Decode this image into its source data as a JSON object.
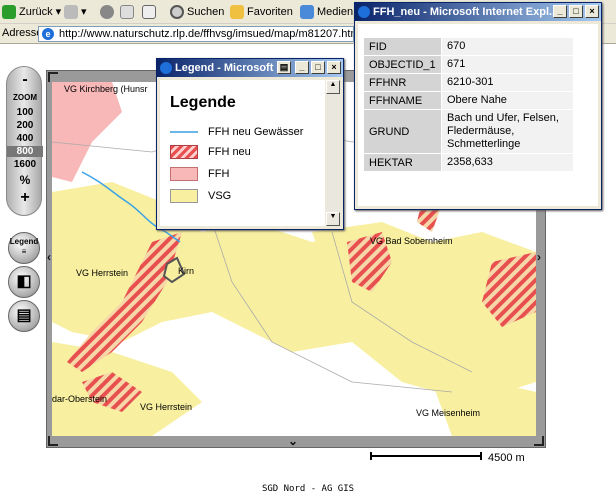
{
  "toolbar": {
    "back": "Zurück",
    "search": "Suchen",
    "favorites": "Favoriten",
    "media": "Medien"
  },
  "address": {
    "label": "Adresse",
    "url": "http://www.naturschutz.rlp.de/ffhvsg/imsued/map/m81207.html"
  },
  "zoom": {
    "minus": "-",
    "label": "ZOOM",
    "levels": [
      "100",
      "200",
      "400",
      "800",
      "1600"
    ],
    "selected": "800",
    "percent": "%",
    "plus": "+"
  },
  "side_buttons": {
    "legend": "Legend"
  },
  "map": {
    "labels": [
      "VG Kirchberg (Hunsr",
      "VG Bad Sobernheim",
      "VG Herrstein",
      "Kirn",
      "dar-Oberstein",
      "VG Herrstein",
      "VG Meisenheim"
    ],
    "scale_label": "4500 m"
  },
  "legend_window": {
    "title": "Legend - Microsoft",
    "heading": "Legende",
    "items": [
      {
        "label": "FFH neu Gewässer",
        "type": "line",
        "color": "#6bb8e8"
      },
      {
        "label": "FFH neu",
        "type": "hatch",
        "color": "#e85050"
      },
      {
        "label": "FFH",
        "type": "fill",
        "color": "#f8b8b8"
      },
      {
        "label": "VSG",
        "type": "fill",
        "color": "#f8f0a0"
      }
    ]
  },
  "ffh_window": {
    "title": "FFH_neu - Microsoft Internet Expl...",
    "rows": [
      {
        "key": "FID",
        "value": "670"
      },
      {
        "key": "OBJECTID_1",
        "value": "671"
      },
      {
        "key": "FFHNR",
        "value": "6210-301"
      },
      {
        "key": "FFHNAME",
        "value": "Obere Nahe"
      },
      {
        "key": "GRUND",
        "value": "Bach und Ufer, Felsen, Fledermäuse, Schmetterlinge"
      },
      {
        "key": "HEKTAR",
        "value": "2358,633"
      }
    ]
  },
  "footer": "SGD Nord - AG GIS"
}
